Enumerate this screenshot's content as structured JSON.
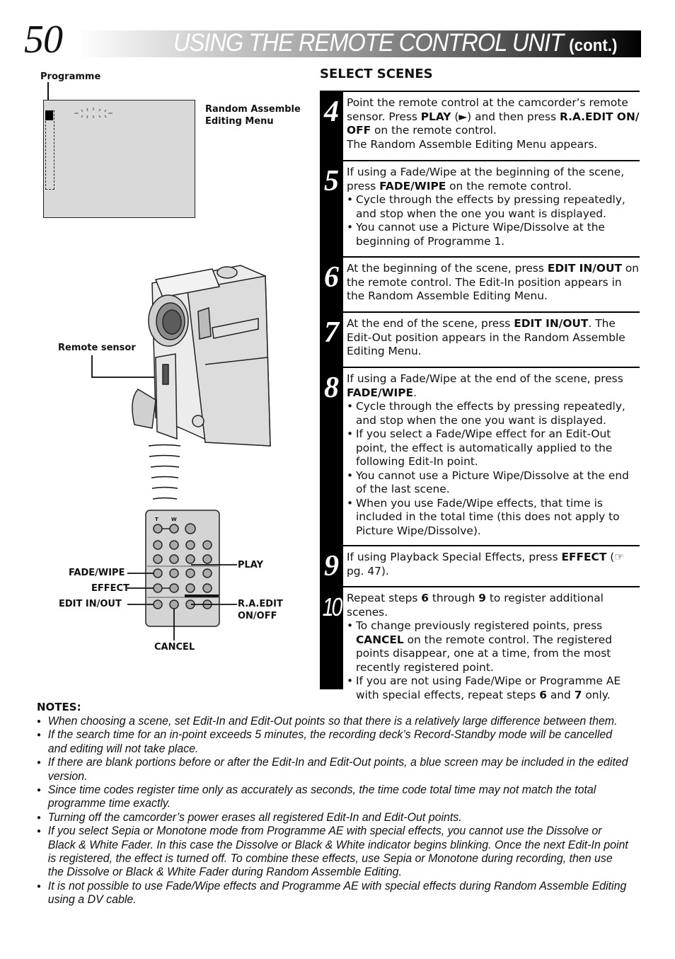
{
  "header": {
    "page_number": "50",
    "title": "USING THE REMOTE CONTROL UNIT",
    "title_suffix": "(cont.)"
  },
  "screen_diagram": {
    "programme_label": "Programme",
    "menu_label_line1": "Random Assemble",
    "menu_label_line2": "Editing Menu"
  },
  "camera_diagram": {
    "remote_sensor_label": "Remote sensor"
  },
  "remote_diagram": {
    "top_labels": [
      "T",
      "W"
    ],
    "left_labels": [
      "FADE/WIPE",
      "EFFECT",
      "EDIT IN/OUT"
    ],
    "right_labels": [
      "PLAY",
      "R.A.EDIT",
      "ON/OFF"
    ],
    "bottom_label": "CANCEL"
  },
  "section": {
    "title": "SELECT SCENES"
  },
  "steps": [
    {
      "number": "4",
      "paragraphs": [
        [
          {
            "t": "Point the remote control at the camcorder’s remote sensor. Press "
          },
          {
            "t": "PLAY",
            "b": true
          },
          {
            "t": " (►) and then press "
          },
          {
            "t": "R.A.EDIT ON/ OFF",
            "b": true
          },
          {
            "t": " on the remote control."
          }
        ],
        [
          {
            "t": "The Random Assemble Editing Menu appears."
          }
        ]
      ],
      "bullets": []
    },
    {
      "number": "5",
      "paragraphs": [
        [
          {
            "t": "If using a Fade/Wipe at the beginning of the scene, press "
          },
          {
            "t": "FADE/WIPE",
            "b": true
          },
          {
            "t": " on the remote control."
          }
        ]
      ],
      "bullets": [
        [
          {
            "t": "Cycle through the effects by pressing repeatedly, and stop when the one you want is displayed."
          }
        ],
        [
          {
            "t": "You cannot use a Picture Wipe/Dissolve at the beginning of Programme 1."
          }
        ]
      ]
    },
    {
      "number": "6",
      "paragraphs": [
        [
          {
            "t": "At the beginning of the scene, press "
          },
          {
            "t": "EDIT IN/OUT",
            "b": true
          },
          {
            "t": " on the remote control. The Edit-In position appears in the Random Assemble Editing Menu."
          }
        ]
      ],
      "bullets": []
    },
    {
      "number": "7",
      "paragraphs": [
        [
          {
            "t": "At the end of the scene, press "
          },
          {
            "t": "EDIT IN/OUT",
            "b": true
          },
          {
            "t": ". The Edit-Out position appears in the Random Assemble Editing Menu."
          }
        ]
      ],
      "bullets": []
    },
    {
      "number": "8",
      "paragraphs": [
        [
          {
            "t": "If using a Fade/Wipe at the end of the scene, press "
          },
          {
            "t": "FADE/WIPE",
            "b": true
          },
          {
            "t": "."
          }
        ]
      ],
      "bullets": [
        [
          {
            "t": "Cycle through the effects by pressing repeatedly, and stop when the one you want is displayed."
          }
        ],
        [
          {
            "t": "If you select a Fade/Wipe effect for an Edit-Out point, the effect is automatically applied to the following Edit-In point."
          }
        ],
        [
          {
            "t": "You cannot use a Picture Wipe/Dissolve at the end of the last scene."
          }
        ],
        [
          {
            "t": "When you use Fade/Wipe effects, that time is included in the total time (this does not apply to Picture Wipe/Dissolve)."
          }
        ]
      ]
    },
    {
      "number": "9",
      "paragraphs": [
        [
          {
            "t": "If using Playback Special Effects, press "
          },
          {
            "t": "EFFECT",
            "b": true
          },
          {
            "t": " (☞ pg. 47)."
          }
        ]
      ],
      "bullets": []
    },
    {
      "number": "10",
      "paragraphs": [
        [
          {
            "t": "Repeat steps "
          },
          {
            "t": "6",
            "b": true
          },
          {
            "t": " through "
          },
          {
            "t": "9",
            "b": true
          },
          {
            "t": " to register additional scenes."
          }
        ]
      ],
      "bullets": [
        [
          {
            "t": "To change previously registered points, press "
          },
          {
            "t": "CANCEL",
            "b": true
          },
          {
            "t": " on the remote control. The registered points disappear, one at a time, from the most recently registered point."
          }
        ],
        [
          {
            "t": "If you are not using Fade/Wipe or Programme AE with special effects, repeat steps "
          },
          {
            "t": "6",
            "b": true
          },
          {
            "t": " and "
          },
          {
            "t": "7",
            "b": true
          },
          {
            "t": " only."
          }
        ]
      ]
    }
  ],
  "notes": {
    "title": "NOTES:",
    "items": [
      "When choosing a scene, set Edit-In and Edit-Out points so that there is a relatively large difference between them.",
      "If the search time for an in-point exceeds 5 minutes, the recording deck’s Record-Standby mode will be cancelled and editing will not take place.",
      "If there are blank portions before or after the Edit-In and Edit-Out points, a blue screen may be included in the edited version.",
      "Since time codes register time only as accurately as seconds, the time code total time may not match the total programme time exactly.",
      "Turning off the camcorder’s power erases all registered Edit-In and Edit-Out points.",
      "If you select Sepia or Monotone mode from Programme AE with special effects, you cannot use the Dissolve or Black & White Fader. In this case the Dissolve or Black & White indicator begins blinking. Once the next Edit-In point is registered, the effect is turned off. To combine these effects, use Sepia or Monotone during recording, then use the Dissolve or Black & White Fader during Random Assemble Editing.",
      "It is not possible to use Fade/Wipe effects and Programme AE with special effects during Random Assemble Editing using a DV cable."
    ]
  }
}
